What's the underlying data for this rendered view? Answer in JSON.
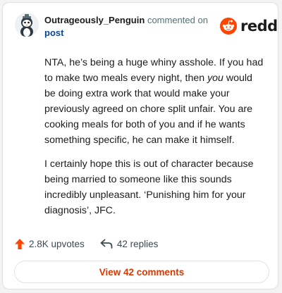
{
  "comment": {
    "username": "Outrageously_Penguin",
    "action_text": "commented on",
    "post_link": "post",
    "body": {
      "p1_before": "NTA, he’s being a huge whiny asshole. If you had to make two meals every night, then ",
      "p1_em": "you",
      "p1_after": " would be doing extra work that would make your previously agreed on chore split unfair. You are cooking meals for both of you and if he wants something specific, he can make it himself.",
      "p2": "I certainly hope this is out of character because being married to someone like this sounds incredibly unpleasant. ‘Punishing him for your diagnosis’, JFC."
    },
    "upvotes": "2.8K upvotes",
    "replies": "42 replies",
    "view_comments": "View 42 comments"
  },
  "brand": {
    "name": "reddit",
    "logo_icon": "reddit-snoo-icon",
    "accent_color": "#ff4500"
  },
  "icons": {
    "upvote": "upvote-arrow-icon",
    "reply": "reply-arrow-icon",
    "avatar": "penguin-avatar"
  }
}
